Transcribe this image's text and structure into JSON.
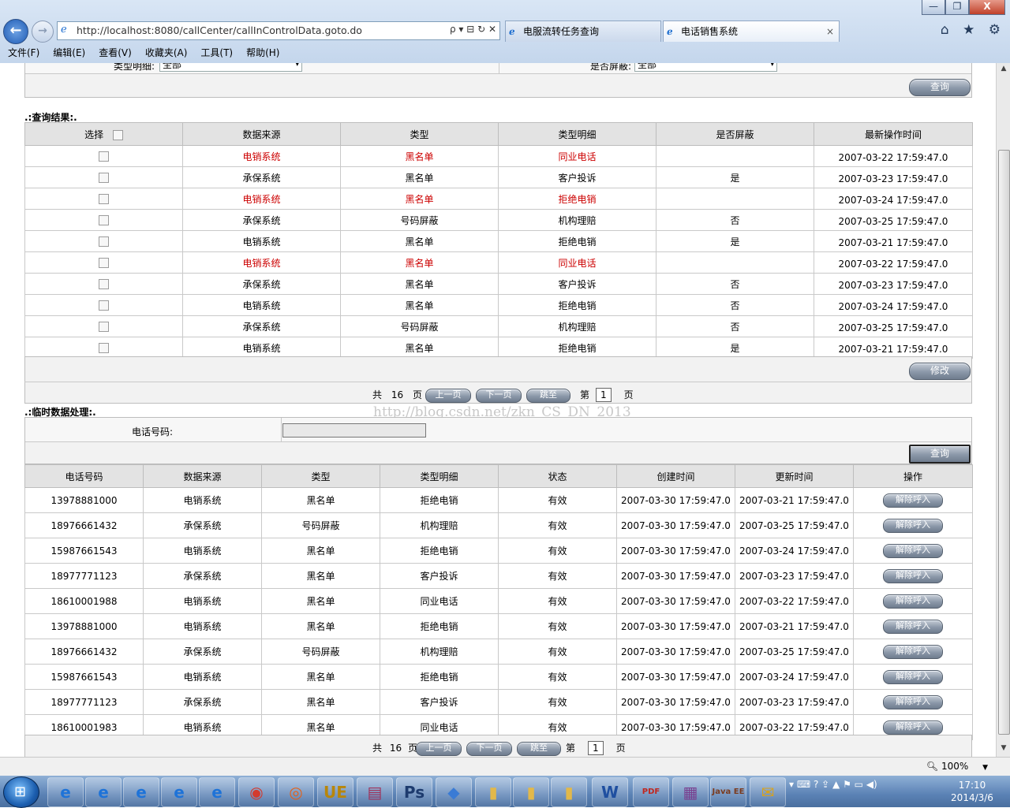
{
  "browser": {
    "url": "http://localhost:8080/callCenter/callInControlData.goto.do",
    "tabs": [
      {
        "label": "电服流转任务查询"
      },
      {
        "label": "电话销售系统",
        "close": "×"
      }
    ],
    "menus": [
      "文件(F)",
      "编辑(E)",
      "查看(V)",
      "收藏夹(A)",
      "工具(T)",
      "帮助(H)"
    ],
    "window_buttons": [
      "—",
      "❐",
      "X"
    ],
    "address_tools": "ρ ▾ ⊟ ↻ ✕",
    "right_icons": "⌂ ★ ⚙",
    "zoom": "100%"
  },
  "filter_top": {
    "type_detail_label": "类型明细:",
    "type_detail_value": "全部",
    "blocked_label": "是否屏蔽:",
    "blocked_value": "全部",
    "query_button": "查询"
  },
  "results": {
    "title": ".:查询结果:.",
    "headers": [
      "选择",
      "数据来源",
      "类型",
      "类型明细",
      "是否屏蔽",
      "最新操作时间"
    ],
    "rows": [
      {
        "source": "电销系统",
        "type": "黑名单",
        "detail": "同业电话",
        "blocked": "",
        "time": "2007-03-22 17:59:47.0",
        "highlight": true
      },
      {
        "source": "承保系统",
        "type": "黑名单",
        "detail": "客户投诉",
        "blocked": "是",
        "time": "2007-03-23 17:59:47.0",
        "highlight": false
      },
      {
        "source": "电销系统",
        "type": "黑名单",
        "detail": "拒绝电销",
        "blocked": "",
        "time": "2007-03-24 17:59:47.0",
        "highlight": true
      },
      {
        "source": "承保系统",
        "type": "号码屏蔽",
        "detail": "机构理赔",
        "blocked": "否",
        "time": "2007-03-25 17:59:47.0",
        "highlight": false
      },
      {
        "source": "电销系统",
        "type": "黑名单",
        "detail": "拒绝电销",
        "blocked": "是",
        "time": "2007-03-21 17:59:47.0",
        "highlight": false
      },
      {
        "source": "电销系统",
        "type": "黑名单",
        "detail": "同业电话",
        "blocked": "",
        "time": "2007-03-22 17:59:47.0",
        "highlight": true
      },
      {
        "source": "承保系统",
        "type": "黑名单",
        "detail": "客户投诉",
        "blocked": "否",
        "time": "2007-03-23 17:59:47.0",
        "highlight": false
      },
      {
        "source": "电销系统",
        "type": "黑名单",
        "detail": "拒绝电销",
        "blocked": "否",
        "time": "2007-03-24 17:59:47.0",
        "highlight": false
      },
      {
        "source": "承保系统",
        "type": "号码屏蔽",
        "detail": "机构理赔",
        "blocked": "否",
        "time": "2007-03-25 17:59:47.0",
        "highlight": false
      },
      {
        "source": "电销系统",
        "type": "黑名单",
        "detail": "拒绝电销",
        "blocked": "是",
        "time": "2007-03-21 17:59:47.0",
        "highlight": false
      }
    ],
    "modify_button": "修改",
    "pager": {
      "total_prefix": "共",
      "total": "16",
      "total_suffix": "页",
      "prev": "上一页",
      "next": "下一页",
      "jump": "跳至",
      "page_prefix": "第",
      "page": "1",
      "page_suffix": "页"
    }
  },
  "watermark": "http://blog.csdn.net/zkn_CS_DN_2013",
  "temp": {
    "title": ".:临时数据处理:.",
    "phone_label": "电话号码:",
    "phone_value": "",
    "query_button": "查询",
    "headers": [
      "电话号码",
      "数据来源",
      "类型",
      "类型明细",
      "状态",
      "创建时间",
      "更新时间",
      "操作"
    ],
    "rows": [
      {
        "phone": "13978881000",
        "source": "电销系统",
        "type": "黑名单",
        "detail": "拒绝电销",
        "status": "有效",
        "created": "2007-03-30 17:59:47.0",
        "updated": "2007-03-21 17:59:47.0",
        "action": "解除呼入"
      },
      {
        "phone": "18976661432",
        "source": "承保系统",
        "type": "号码屏蔽",
        "detail": "机构理赔",
        "status": "有效",
        "created": "2007-03-30 17:59:47.0",
        "updated": "2007-03-25 17:59:47.0",
        "action": "解除呼入"
      },
      {
        "phone": "15987661543",
        "source": "电销系统",
        "type": "黑名单",
        "detail": "拒绝电销",
        "status": "有效",
        "created": "2007-03-30 17:59:47.0",
        "updated": "2007-03-24 17:59:47.0",
        "action": "解除呼入"
      },
      {
        "phone": "18977771123",
        "source": "承保系统",
        "type": "黑名单",
        "detail": "客户投诉",
        "status": "有效",
        "created": "2007-03-30 17:59:47.0",
        "updated": "2007-03-23 17:59:47.0",
        "action": "解除呼入"
      },
      {
        "phone": "18610001988",
        "source": "电销系统",
        "type": "黑名单",
        "detail": "同业电话",
        "status": "有效",
        "created": "2007-03-30 17:59:47.0",
        "updated": "2007-03-22 17:59:47.0",
        "action": "解除呼入"
      },
      {
        "phone": "13978881000",
        "source": "电销系统",
        "type": "黑名单",
        "detail": "拒绝电销",
        "status": "有效",
        "created": "2007-03-30 17:59:47.0",
        "updated": "2007-03-21 17:59:47.0",
        "action": "解除呼入"
      },
      {
        "phone": "18976661432",
        "source": "承保系统",
        "type": "号码屏蔽",
        "detail": "机构理赔",
        "status": "有效",
        "created": "2007-03-30 17:59:47.0",
        "updated": "2007-03-25 17:59:47.0",
        "action": "解除呼入"
      },
      {
        "phone": "15987661543",
        "source": "电销系统",
        "type": "黑名单",
        "detail": "拒绝电销",
        "status": "有效",
        "created": "2007-03-30 17:59:47.0",
        "updated": "2007-03-24 17:59:47.0",
        "action": "解除呼入"
      },
      {
        "phone": "18977771123",
        "source": "承保系统",
        "type": "黑名单",
        "detail": "客户投诉",
        "status": "有效",
        "created": "2007-03-30 17:59:47.0",
        "updated": "2007-03-23 17:59:47.0",
        "action": "解除呼入"
      },
      {
        "phone": "18610001983",
        "source": "电销系统",
        "type": "黑名单",
        "detail": "同业电话",
        "status": "有效",
        "created": "2007-03-30 17:59:47.0",
        "updated": "2007-03-22 17:59:47.0",
        "action": "解除呼入"
      }
    ],
    "pager": {
      "total_prefix": "共",
      "total": "16",
      "total_suffix": "页",
      "prev": "上一页",
      "next": "下一页",
      "jump": "跳至",
      "page_prefix": "第",
      "page": "1",
      "page_suffix": "页"
    }
  },
  "taskbar": {
    "apps": [
      {
        "icon": "ie-icon",
        "glyph": "e"
      },
      {
        "icon": "ie-icon",
        "glyph": "e"
      },
      {
        "icon": "ie-icon",
        "glyph": "e"
      },
      {
        "icon": "ie-icon",
        "glyph": "e"
      },
      {
        "icon": "ie-icon",
        "glyph": "e"
      },
      {
        "icon": "chrome-icon",
        "glyph": "◉"
      },
      {
        "icon": "firefox-icon",
        "glyph": "◎"
      },
      {
        "icon": "ultraedit-icon",
        "glyph": "UE"
      },
      {
        "icon": "database-icon",
        "glyph": "▤"
      },
      {
        "icon": "photoshop-icon",
        "glyph": "Ps"
      },
      {
        "icon": "network-icon",
        "glyph": "◆"
      },
      {
        "icon": "folder-icon",
        "glyph": "▮"
      },
      {
        "icon": "folder-icon",
        "glyph": "▮"
      },
      {
        "icon": "folder-icon",
        "glyph": "▮"
      },
      {
        "icon": "word-icon",
        "glyph": "W"
      },
      {
        "icon": "pdf-icon",
        "glyph": "PDF"
      },
      {
        "icon": "winrar-icon",
        "glyph": "▦"
      },
      {
        "icon": "javaee-icon",
        "glyph": "Java EE"
      },
      {
        "icon": "mail-icon",
        "glyph": "✉"
      }
    ],
    "tray": "▾ ⌨ ? ⇪ ▲ ⚑ ▭ ◀)",
    "time": "17:10",
    "date": "2014/3/6"
  }
}
